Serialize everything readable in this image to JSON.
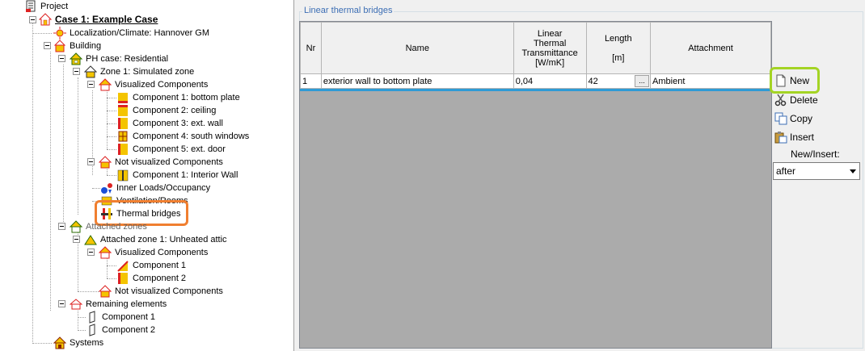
{
  "tree": {
    "project": "Project",
    "case": "Case 1: Example Case",
    "localization": "Localization/Climate: Hannover GM",
    "building": "Building",
    "ph_case": "PH case: Residential",
    "zone1": "Zone 1: Simulated zone",
    "visualized": "Visualized Components",
    "comp1": "Component 1: bottom plate",
    "comp2": "Component 2: ceiling",
    "comp3": "Component 3: ext. wall",
    "comp4": "Component 4: south windows",
    "comp5": "Component 5: ext. door",
    "not_visualized": "Not visualized Components",
    "interior_wall": "Component 1: Interior Wall",
    "inner_loads": "Inner Loads/Occupancy",
    "ventilation": "Ventilation/Rooms",
    "thermal_bridges": "Thermal bridges",
    "attached_zones": "Attached zones",
    "attached_zone1": "Attached zone 1: Unheated attic",
    "az_visualized": "Visualized Components",
    "az_comp1": "Component 1",
    "az_comp2": "Component 2",
    "az_not_visualized": "Not visualized Components",
    "remaining": "Remaining elements",
    "rem_comp1": "Component 1",
    "rem_comp2": "Component 2",
    "systems": "Systems"
  },
  "panel": {
    "group_title": "Linear thermal bridges"
  },
  "table": {
    "headers": {
      "nr": "Nr",
      "name": "Name",
      "psi_line1": "Linear",
      "psi_line2": "Thermal",
      "psi_line3": "Transmittance",
      "psi_line4": "[W/mK]",
      "length_line1": "Length",
      "length_line2": "[m]",
      "attachment": "Attachment"
    },
    "rows": [
      {
        "nr": "1",
        "name": "exterior wall to bottom plate",
        "psi": "0,04",
        "length": "42",
        "attachment": "Ambient"
      }
    ],
    "ellipsis": "..."
  },
  "actions": {
    "new": "New",
    "delete": "Delete",
    "copy": "Copy",
    "insert": "Insert",
    "new_insert_label": "New/Insert:",
    "new_insert_value": "after"
  },
  "colors": {
    "highlight_orange": "#f07f30",
    "highlight_green": "#a4d424",
    "selection_blue": "#2e9bd6",
    "title_blue": "#3c6eb4"
  }
}
